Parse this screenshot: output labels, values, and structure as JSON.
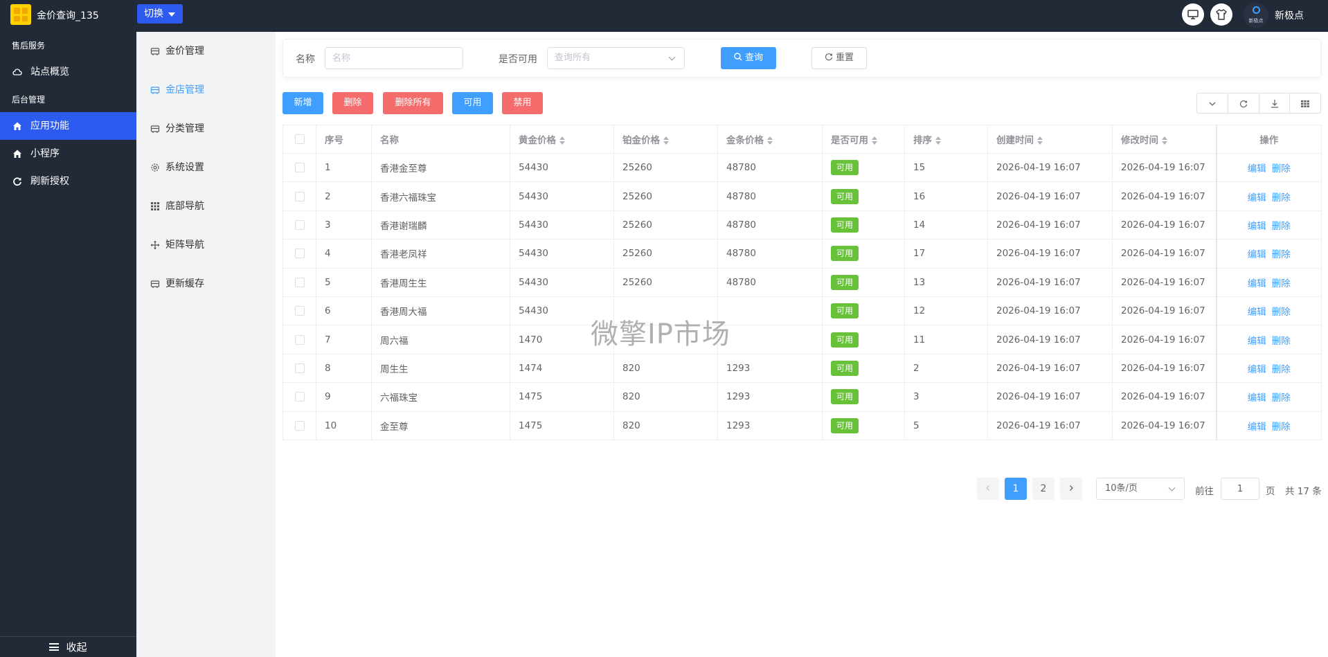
{
  "header": {
    "app_title": "金价查询_135",
    "switch_label": "切换",
    "brand_badge_text": "新极点",
    "brand_name": "新极点"
  },
  "sidebar": {
    "group1": "售后服务",
    "item_overview": "站点概览",
    "group2": "后台管理",
    "item_apps": "应用功能",
    "item_miniapp": "小程序",
    "item_refresh": "刷新授权",
    "collapse_label": "收起"
  },
  "submenu": {
    "items": [
      "金价管理",
      "金店管理",
      "分类管理",
      "系统设置",
      "底部导航",
      "矩阵导航",
      "更新缓存"
    ],
    "active_index": 1
  },
  "search": {
    "name_label": "名称",
    "name_placeholder": "名称",
    "available_label": "是否可用",
    "available_placeholder": "查询所有",
    "query_label": "查询",
    "reset_label": "重置"
  },
  "toolbar": {
    "add": "新增",
    "delete": "删除",
    "delete_all": "删除所有",
    "enable": "可用",
    "disable": "禁用"
  },
  "table": {
    "headers": [
      "序号",
      "名称",
      "黄金价格",
      "铂金价格",
      "金条价格",
      "是否可用",
      "排序",
      "创建时间",
      "修改时间",
      "操作"
    ],
    "action_edit": "编辑",
    "action_delete": "删除",
    "rows": [
      {
        "id": "1",
        "name": "香港金至尊",
        "gold": "54430",
        "platinum": "25260",
        "bar": "48780",
        "status": "可用",
        "sort": "15",
        "created": "2026-04-19 16:07",
        "modified": "2026-04-19 16:07"
      },
      {
        "id": "2",
        "name": "香港六福珠宝",
        "gold": "54430",
        "platinum": "25260",
        "bar": "48780",
        "status": "可用",
        "sort": "16",
        "created": "2026-04-19 16:07",
        "modified": "2026-04-19 16:07"
      },
      {
        "id": "3",
        "name": "香港谢瑞麟",
        "gold": "54430",
        "platinum": "25260",
        "bar": "48780",
        "status": "可用",
        "sort": "14",
        "created": "2026-04-19 16:07",
        "modified": "2026-04-19 16:07"
      },
      {
        "id": "4",
        "name": "香港老凤祥",
        "gold": "54430",
        "platinum": "25260",
        "bar": "48780",
        "status": "可用",
        "sort": "17",
        "created": "2026-04-19 16:07",
        "modified": "2026-04-19 16:07"
      },
      {
        "id": "5",
        "name": "香港周生生",
        "gold": "54430",
        "platinum": "25260",
        "bar": "48780",
        "status": "可用",
        "sort": "13",
        "created": "2026-04-19 16:07",
        "modified": "2026-04-19 16:07"
      },
      {
        "id": "6",
        "name": "香港周大福",
        "gold": "54430",
        "platinum": "",
        "bar": "",
        "status": "可用",
        "sort": "12",
        "created": "2026-04-19 16:07",
        "modified": "2026-04-19 16:07"
      },
      {
        "id": "7",
        "name": "周六福",
        "gold": "1470",
        "platinum": "",
        "bar": "",
        "status": "可用",
        "sort": "11",
        "created": "2026-04-19 16:07",
        "modified": "2026-04-19 16:07"
      },
      {
        "id": "8",
        "name": "周生生",
        "gold": "1474",
        "platinum": "820",
        "bar": "1293",
        "status": "可用",
        "sort": "2",
        "created": "2026-04-19 16:07",
        "modified": "2026-04-19 16:07"
      },
      {
        "id": "9",
        "name": "六福珠宝",
        "gold": "1475",
        "platinum": "820",
        "bar": "1293",
        "status": "可用",
        "sort": "3",
        "created": "2026-04-19 16:07",
        "modified": "2026-04-19 16:07"
      },
      {
        "id": "10",
        "name": "金至尊",
        "gold": "1475",
        "platinum": "820",
        "bar": "1293",
        "status": "可用",
        "sort": "5",
        "created": "2026-04-19 16:07",
        "modified": "2026-04-19 16:07"
      }
    ]
  },
  "watermark": "微擎IP市场",
  "pagination": {
    "pages": [
      "1",
      "2"
    ],
    "current": "1",
    "page_size": "10条/页",
    "goto_label": "前往",
    "goto_value": "1",
    "page_unit": "页",
    "total": "共 17 条"
  },
  "colors": {
    "topbar": "#232a37",
    "accent": "#2d5bf0",
    "primary": "#409eff",
    "danger": "#f56c6c",
    "success": "#67c23a"
  }
}
